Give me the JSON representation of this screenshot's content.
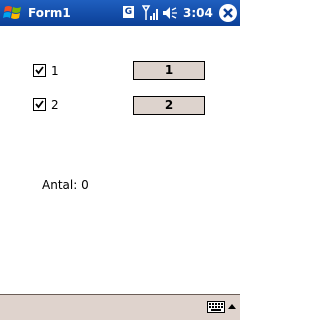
{
  "window": {
    "title": "Form1"
  },
  "status": {
    "clock": "3:04",
    "network_badge": "G",
    "icons": [
      "windows-start-icon",
      "signal-icon",
      "volume-icon",
      "close-icon",
      "keyboard-icon",
      "up-arrow-icon"
    ]
  },
  "form": {
    "rows": [
      {
        "checkbox_label": "1",
        "checked": true,
        "button_label": "1"
      },
      {
        "checkbox_label": "2",
        "checked": true,
        "button_label": "2"
      }
    ],
    "count_text": "Antal: 0"
  },
  "colors": {
    "titlebar": "#0b3f97",
    "button_face": "#ddd3cd",
    "menubar": "#dfd3cd"
  }
}
